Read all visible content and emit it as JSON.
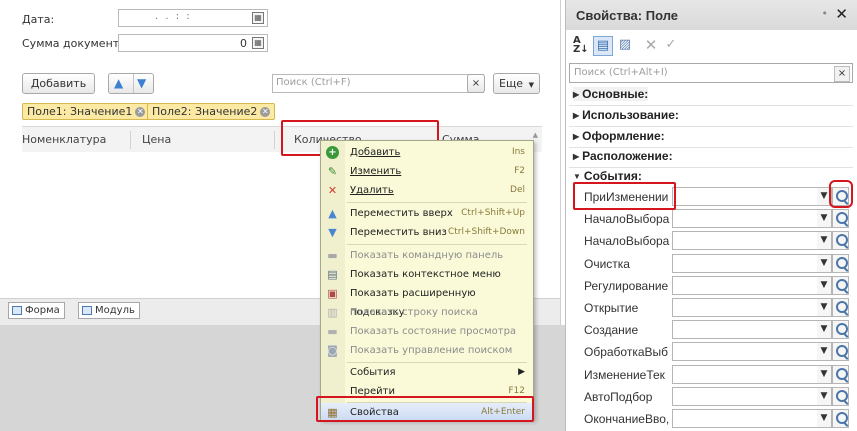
{
  "form": {
    "date_label": "Дата:",
    "date_value": ". .   : :",
    "sum_label": "Сумма документа:",
    "sum_value": "0",
    "add_button": "Добавить",
    "search_placeholder": "Поиск (Ctrl+F)",
    "search_clear": "×",
    "more_button": "Еще",
    "filter_tags": [
      "Поле1: Значение1",
      "Поле2: Значение2"
    ],
    "columns": [
      "Номенклатура",
      "Цена",
      "Количество",
      "Сумма"
    ],
    "bottom_tabs": [
      "Форма",
      "Модуль"
    ]
  },
  "context_menu": {
    "items": [
      {
        "icon": "add-icon",
        "label": "Добавить",
        "shortcut": "Ins",
        "enabled": true
      },
      {
        "icon": "edit-icon",
        "label": "Изменить",
        "shortcut": "F2",
        "enabled": true
      },
      {
        "icon": "delete-icon",
        "label": "Удалить",
        "shortcut": "Del",
        "enabled": true
      },
      {
        "icon": "arrow-up-icon",
        "label": "Переместить вверх",
        "shortcut": "Ctrl+Shift+Up",
        "enabled": true
      },
      {
        "icon": "arrow-down-icon",
        "label": "Переместить вниз",
        "shortcut": "Ctrl+Shift+Down",
        "enabled": true
      },
      {
        "icon": "command-panel-icon",
        "label": "Показать командную панель",
        "shortcut": "",
        "enabled": false
      },
      {
        "icon": "context-menu-icon",
        "label": "Показать контекстное меню",
        "shortcut": "",
        "enabled": true
      },
      {
        "icon": "tooltip-icon",
        "label": "Показать расширенную подсказку",
        "shortcut": "",
        "enabled": true
      },
      {
        "icon": "search-row-icon",
        "label": "Показать строку поиска",
        "shortcut": "",
        "enabled": false
      },
      {
        "icon": "view-state-icon",
        "label": "Показать состояние просмотра",
        "shortcut": "",
        "enabled": false
      },
      {
        "icon": "search-control-icon",
        "label": "Показать управление поиском",
        "shortcut": "",
        "enabled": false
      },
      {
        "icon": "",
        "label": "События",
        "shortcut": "",
        "enabled": true
      },
      {
        "icon": "",
        "label": "Перейти",
        "shortcut": "F12",
        "enabled": true
      },
      {
        "icon": "properties-icon",
        "label": "Свойства",
        "shortcut": "Alt+Enter",
        "enabled": true
      }
    ]
  },
  "properties": {
    "title": "Свойства: Поле",
    "pin": "•",
    "close": "✕",
    "toolbar": [
      "sort-alpha-icon",
      "categories-icon",
      "filter-icon",
      "clear-icon",
      "check-icon"
    ],
    "search_placeholder": "Поиск (Ctrl+Alt+I)",
    "search_clear": "×",
    "groups": [
      "Основные:",
      "Использование:",
      "Оформление:",
      "Расположение:",
      "События:"
    ],
    "events": [
      "ПриИзменении",
      "НачалоВыбора",
      "НачалоВыбора",
      "Очистка",
      "Регулирование",
      "Открытие",
      "Создание",
      "ОбработкаВыб",
      "ИзменениеТек",
      "АвтоПодбор",
      "ОкончаниеВво,"
    ]
  },
  "colors": {
    "highlight_box": "#d4161f",
    "menu_background": "#fafad9",
    "filter_tag": "#fbe9a4"
  }
}
